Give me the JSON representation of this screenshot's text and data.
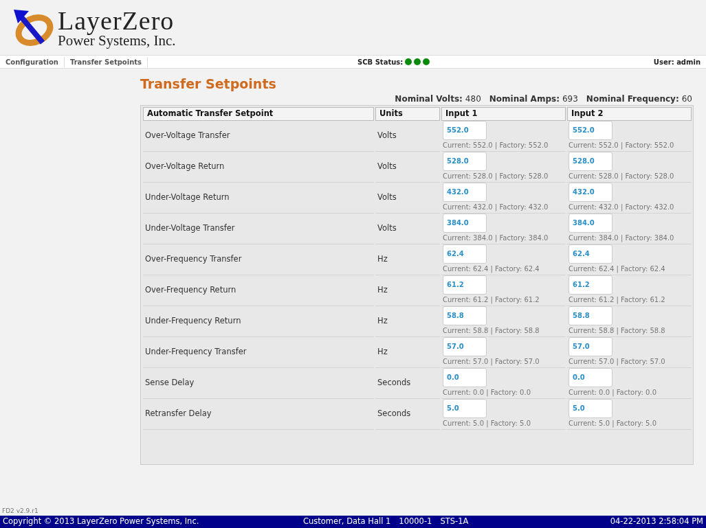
{
  "logo": {
    "name": "LayerZero",
    "subtitle": "Power Systems, Inc."
  },
  "breadcrumbs": [
    {
      "label": "Configuration"
    },
    {
      "label": "Transfer Setpoints"
    }
  ],
  "scb_status": {
    "label": "SCB Status:",
    "dots": [
      {
        "color": "#0a8a0a"
      },
      {
        "color": "#0a8a0a"
      },
      {
        "color": "#0a8a0a"
      }
    ]
  },
  "user": "User: admin",
  "page_title": "Transfer Setpoints",
  "nominals": [
    {
      "label": "Nominal Volts:",
      "value": "480"
    },
    {
      "label": "Nominal Amps:",
      "value": "693"
    },
    {
      "label": "Nominal Frequency:",
      "value": "60"
    }
  ],
  "table": {
    "columns": [
      "Automatic Transfer Setpoint",
      "Units",
      "Input 1",
      "Input 2"
    ],
    "rows": [
      {
        "name": "Over-Voltage Transfer",
        "units": "Volts",
        "inputs": [
          {
            "value": "552.0",
            "info": "Current: 552.0 | Factory: 552.0"
          },
          {
            "value": "552.0",
            "info": "Current: 552.0 | Factory: 552.0"
          }
        ]
      },
      {
        "name": "Over-Voltage Return",
        "units": "Volts",
        "inputs": [
          {
            "value": "528.0",
            "info": "Current: 528.0 | Factory: 528.0"
          },
          {
            "value": "528.0",
            "info": "Current: 528.0 | Factory: 528.0"
          }
        ]
      },
      {
        "name": "Under-Voltage Return",
        "units": "Volts",
        "inputs": [
          {
            "value": "432.0",
            "info": "Current: 432.0 | Factory: 432.0"
          },
          {
            "value": "432.0",
            "info": "Current: 432.0 | Factory: 432.0"
          }
        ]
      },
      {
        "name": "Under-Voltage Transfer",
        "units": "Volts",
        "inputs": [
          {
            "value": "384.0",
            "info": "Current: 384.0 | Factory: 384.0"
          },
          {
            "value": "384.0",
            "info": "Current: 384.0 | Factory: 384.0"
          }
        ]
      },
      {
        "name": "Over-Frequency Transfer",
        "units": "Hz",
        "inputs": [
          {
            "value": "62.4",
            "info": "Current: 62.4 | Factory: 62.4"
          },
          {
            "value": "62.4",
            "info": "Current: 62.4 | Factory: 62.4"
          }
        ]
      },
      {
        "name": "Over-Frequency Return",
        "units": "Hz",
        "inputs": [
          {
            "value": "61.2",
            "info": "Current: 61.2 | Factory: 61.2"
          },
          {
            "value": "61.2",
            "info": "Current: 61.2 | Factory: 61.2"
          }
        ]
      },
      {
        "name": "Under-Frequency Return",
        "units": "Hz",
        "inputs": [
          {
            "value": "58.8",
            "info": "Current: 58.8 | Factory: 58.8"
          },
          {
            "value": "58.8",
            "info": "Current: 58.8 | Factory: 58.8"
          }
        ]
      },
      {
        "name": "Under-Frequency Transfer",
        "units": "Hz",
        "inputs": [
          {
            "value": "57.0",
            "info": "Current: 57.0 | Factory: 57.0"
          },
          {
            "value": "57.0",
            "info": "Current: 57.0 | Factory: 57.0"
          }
        ]
      },
      {
        "name": "Sense Delay",
        "units": "Seconds",
        "inputs": [
          {
            "value": "0.0",
            "info": "Current: 0.0 | Factory: 0.0"
          },
          {
            "value": "0.0",
            "info": "Current: 0.0 | Factory: 0.0"
          }
        ]
      },
      {
        "name": "Retransfer Delay",
        "units": "Seconds",
        "inputs": [
          {
            "value": "5.0",
            "info": "Current: 5.0 | Factory: 5.0"
          },
          {
            "value": "5.0",
            "info": "Current: 5.0 | Factory: 5.0"
          }
        ]
      }
    ]
  },
  "version": "FD2 v2.9.r1",
  "status_bar": {
    "copyright": "Copyright © 2013 LayerZero Power Systems, Inc.",
    "site": [
      "Customer, Data Hall 1",
      "10000-1",
      "STS-1A"
    ],
    "datetime": "04-22-2013 2:58:04 PM"
  }
}
